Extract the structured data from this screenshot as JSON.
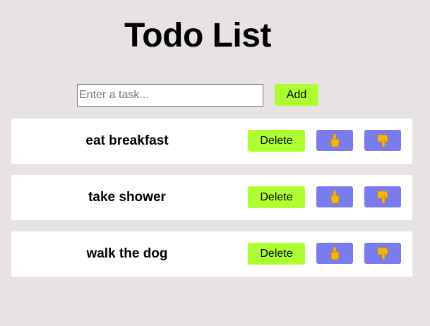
{
  "header": {
    "title": "Todo List"
  },
  "add_form": {
    "input_value": "",
    "input_placeholder": "Enter a task...",
    "add_label": "Add"
  },
  "tasks": [
    {
      "text": "eat breakfast",
      "delete_label": "Delete",
      "up_icon": "pointing-up-icon",
      "down_icon": "pointing-down-icon"
    },
    {
      "text": "take shower",
      "delete_label": "Delete",
      "up_icon": "pointing-up-icon",
      "down_icon": "pointing-down-icon"
    },
    {
      "text": "walk the dog",
      "delete_label": "Delete",
      "up_icon": "pointing-up-icon",
      "down_icon": "pointing-down-icon"
    }
  ],
  "colors": {
    "background": "#e7e3e2",
    "accent_green": "#adff2f",
    "move_button": "#7b7bf0",
    "hand_icon": "#f5b800"
  }
}
